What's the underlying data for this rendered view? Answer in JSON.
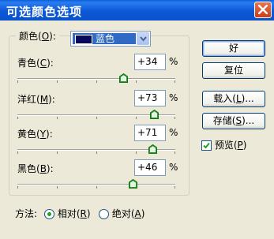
{
  "window": {
    "title": "可选颜色选项"
  },
  "colors_field": {
    "label_prefix": "颜色(",
    "label_key": "O",
    "label_suffix": "):",
    "selected": "蓝色",
    "swatch_color": "#0A0A5A"
  },
  "sliders": [
    {
      "label_prefix": "青色(",
      "key": "C",
      "label_suffix": "):",
      "value": "+34",
      "percent": 34,
      "unit": "%"
    },
    {
      "label_prefix": "洋红(",
      "key": "M",
      "label_suffix": "):",
      "value": "+73",
      "percent": 73,
      "unit": "%"
    },
    {
      "label_prefix": "黄色(",
      "key": "Y",
      "label_suffix": "):",
      "value": "+71",
      "percent": 71,
      "unit": "%"
    },
    {
      "label_prefix": "黑色(",
      "key": "B",
      "label_suffix": "):",
      "value": "+46",
      "percent": 46,
      "unit": "%"
    }
  ],
  "buttons": {
    "ok": "好",
    "reset": "复位",
    "load_prefix": "载入(",
    "load_key": "L",
    "load_suffix": ")...",
    "save_prefix": "存储(",
    "save_key": "S",
    "save_suffix": ")..."
  },
  "preview": {
    "label_prefix": "预览(",
    "key": "P",
    "label_suffix": ")",
    "checked": true
  },
  "method": {
    "label": "方法:",
    "relative_prefix": "相对(",
    "relative_key": "R",
    "relative_suffix": ")",
    "absolute_prefix": "绝对(",
    "absolute_key": "A",
    "absolute_suffix": ")",
    "selected": "relative"
  }
}
